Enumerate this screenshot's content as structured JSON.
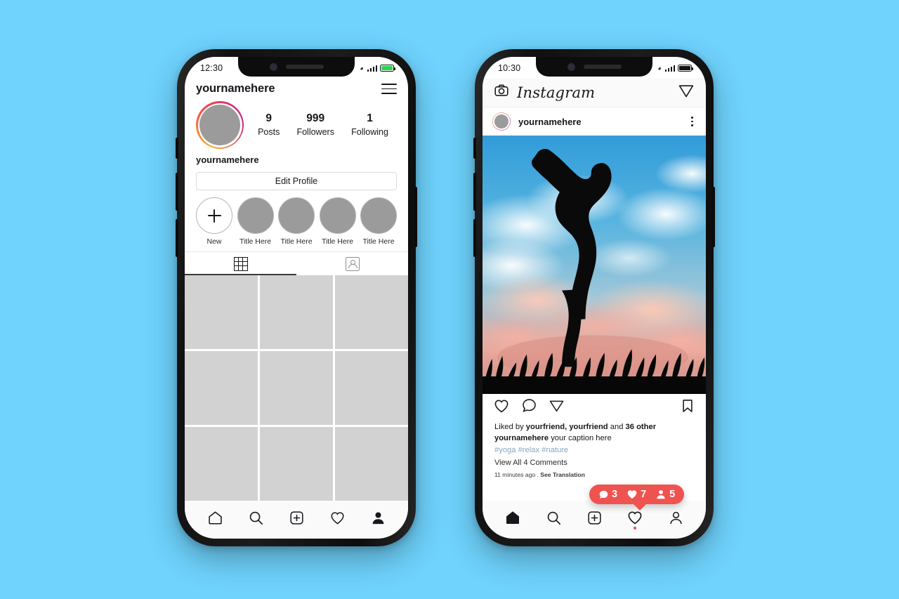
{
  "background_color": "#6fd3fd",
  "accent_color": "#ef5350",
  "phone_left": {
    "name": "instagram-profile-mockup",
    "status_bar": {
      "time": "12:30",
      "wifi_icon": "wifi-icon",
      "signal_icon": "signal-bars-icon",
      "battery_icon": "battery-full-icon",
      "battery_color": "#2bd551"
    },
    "profile": {
      "username_header": "yournamehere",
      "menu_icon": "hamburger-menu-icon",
      "avatar_icon": "profile-avatar",
      "stats": [
        {
          "number": "9",
          "label": "Posts"
        },
        {
          "number": "999",
          "label": "Followers"
        },
        {
          "number": "1",
          "label": "Following"
        }
      ],
      "display_name": "yournamehere",
      "edit_button": "Edit Profile",
      "highlights": [
        {
          "label": "New",
          "icon": "plus-icon"
        },
        {
          "label": "Title Here",
          "icon": "highlight-thumb"
        },
        {
          "label": "Title Here",
          "icon": "highlight-thumb"
        },
        {
          "label": "Title Here",
          "icon": "highlight-thumb"
        },
        {
          "label": "Title Here",
          "icon": "highlight-thumb"
        }
      ],
      "tabs": [
        {
          "name": "grid-tab",
          "icon": "grid-icon",
          "active": true
        },
        {
          "name": "tagged-tab",
          "icon": "tagged-person-icon",
          "active": false
        }
      ],
      "grid_cells": 9
    },
    "nav": [
      {
        "name": "home",
        "icon": "home-icon",
        "active": false
      },
      {
        "name": "search",
        "icon": "search-icon",
        "active": false
      },
      {
        "name": "create",
        "icon": "plus-square-icon",
        "active": false
      },
      {
        "name": "activity",
        "icon": "heart-icon",
        "active": false
      },
      {
        "name": "profile",
        "icon": "person-icon",
        "active": true
      }
    ]
  },
  "phone_right": {
    "name": "instagram-feed-mockup",
    "status_bar": {
      "time": "10:30",
      "wifi_icon": "wifi-icon",
      "signal_icon": "signal-bars-icon",
      "battery_icon": "battery-full-icon",
      "battery_color": "#111111"
    },
    "header": {
      "camera_icon": "camera-icon",
      "logo_text": "Instagram",
      "direct_icon": "send-paper-plane-icon"
    },
    "post": {
      "avatar_icon": "profile-avatar",
      "username": "yournamehere",
      "more_icon": "kebab-menu-icon",
      "photo_alt": "yoga-silhouette-sunset-photo",
      "actions": {
        "like_icon": "heart-icon",
        "comment_icon": "comment-bubble-icon",
        "share_icon": "send-paper-plane-icon",
        "save_icon": "bookmark-icon"
      },
      "liked_by_prefix": "Liked by ",
      "liked_by_names": "yourfriend, yourfriend",
      "liked_by_middle": " and ",
      "liked_by_others": "36 other",
      "caption_user": "yournamehere",
      "caption_text": " your caption here",
      "hashtags": "#yoga #relax #nature",
      "view_comments": "View All 4 Comments",
      "timestamp": "11 minutes ago . ",
      "see_translation": "See Translation"
    },
    "notification": [
      {
        "icon": "comment-bubble-icon",
        "count": "3"
      },
      {
        "icon": "heart-icon",
        "count": "7"
      },
      {
        "icon": "person-icon",
        "count": "5"
      }
    ],
    "nav": [
      {
        "name": "home",
        "icon": "home-icon",
        "active": true
      },
      {
        "name": "search",
        "icon": "search-icon",
        "active": false
      },
      {
        "name": "create",
        "icon": "plus-square-icon",
        "active": false
      },
      {
        "name": "activity",
        "icon": "heart-icon",
        "active": false,
        "has_dot": true
      },
      {
        "name": "profile",
        "icon": "person-icon",
        "active": false
      }
    ]
  }
}
